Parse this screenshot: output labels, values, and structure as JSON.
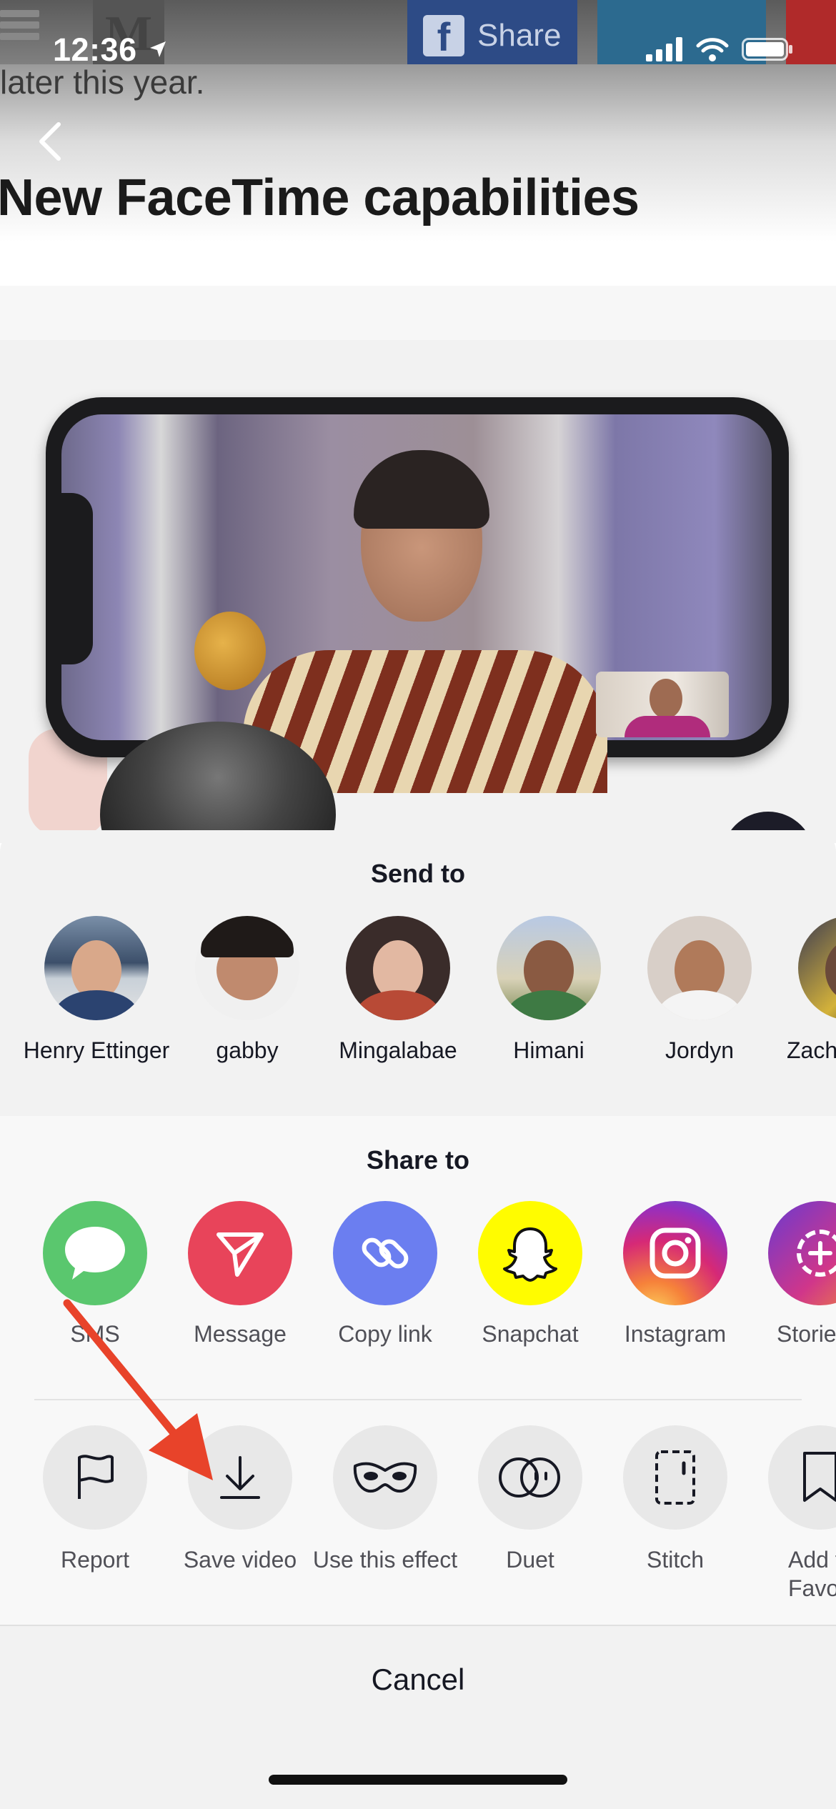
{
  "status_bar": {
    "time": "12:36"
  },
  "background": {
    "prev_text": "later this year.",
    "headline": "New FaceTime capabilities",
    "share_button_label": "Share",
    "logo_letter": "M"
  },
  "sheet": {
    "send_to_title": "Send to",
    "contacts": [
      {
        "name": "Henry Ettinger"
      },
      {
        "name": "gabby"
      },
      {
        "name": "Mingalabae"
      },
      {
        "name": "Himani"
      },
      {
        "name": "Jordyn"
      },
      {
        "name": "Zach"
      }
    ],
    "share_to_title": "Share to",
    "share_apps": [
      {
        "label": "SMS",
        "icon": "sms-bubble-icon",
        "color": "#5ac76e"
      },
      {
        "label": "Message",
        "icon": "paper-plane-icon",
        "color": "#e8445a"
      },
      {
        "label": "Copy link",
        "icon": "link-icon",
        "color": "#6b7ef0"
      },
      {
        "label": "Snapchat",
        "icon": "snapchat-ghost-icon",
        "color": "#fffc00"
      },
      {
        "label": "Instagram",
        "icon": "instagram-icon",
        "color": "#c13584"
      },
      {
        "label": "Stories",
        "icon": "instagram-stories-icon",
        "color": "#8a3ab9"
      }
    ],
    "actions": [
      {
        "label": "Report",
        "icon": "flag-icon"
      },
      {
        "label": "Save video",
        "icon": "download-icon"
      },
      {
        "label": "Use this effect",
        "icon": "mask-icon"
      },
      {
        "label": "Duet",
        "icon": "duet-icon"
      },
      {
        "label": "Stitch",
        "icon": "stitch-icon"
      },
      {
        "label": "Add to Favorites",
        "icon": "bookmark-icon"
      }
    ],
    "cancel_label": "Cancel"
  }
}
